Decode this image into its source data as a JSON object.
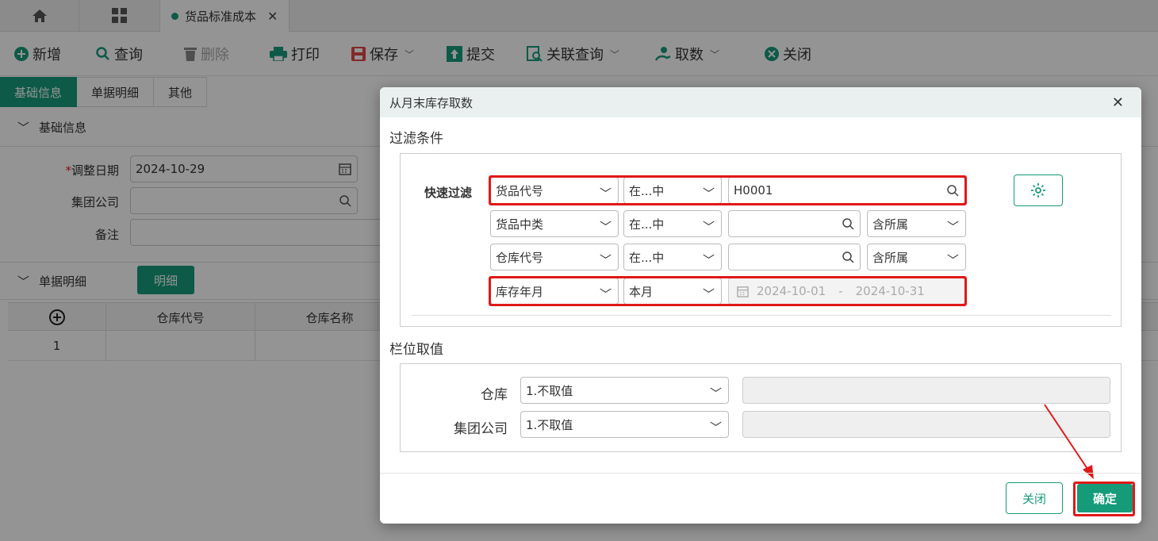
{
  "tabs": {
    "doc_label": "货品标准成本"
  },
  "toolbar": {
    "new": "新增",
    "query": "查询",
    "delete": "删除",
    "print": "打印",
    "save": "保存",
    "submit": "提交",
    "related_query": "关联查询",
    "fetch": "取数",
    "close": "关闭"
  },
  "subtabs": [
    "基础信息",
    "单据明细",
    "其他"
  ],
  "basic": {
    "section_title": "基础信息",
    "adjust_date_label": "调整日期",
    "adjust_date_value": "2024-10-29",
    "group_label": "集团公司",
    "remark_label": "备注"
  },
  "detail": {
    "section_title": "单据明细",
    "detail_button": "明细",
    "columns": [
      "仓库代号",
      "仓库名称"
    ],
    "rows": [
      {
        "index": "1"
      }
    ]
  },
  "modal": {
    "title": "从月末库存取数",
    "filter_title": "过滤条件",
    "quick_filter_label": "快速过滤",
    "filters": [
      {
        "field": "货品代号",
        "op": "在...中",
        "value": "H0001",
        "scope": ""
      },
      {
        "field": "货品中类",
        "op": "在...中",
        "value": "",
        "scope": "含所属"
      },
      {
        "field": "仓库代号",
        "op": "在...中",
        "value": "",
        "scope": "含所属"
      },
      {
        "field": "库存年月",
        "op": "本月",
        "date_from": "2024-10-01",
        "date_sep": "-",
        "date_to": "2024-10-31"
      }
    ],
    "column_title": "栏位取值",
    "column_values": [
      {
        "label": "仓库",
        "value": "1.不取值"
      },
      {
        "label": "集团公司",
        "value": "1.不取值"
      }
    ],
    "close_button": "关闭",
    "confirm_button": "确定"
  },
  "colors": {
    "accent": "#159b7a",
    "highlight": "#e01818"
  }
}
